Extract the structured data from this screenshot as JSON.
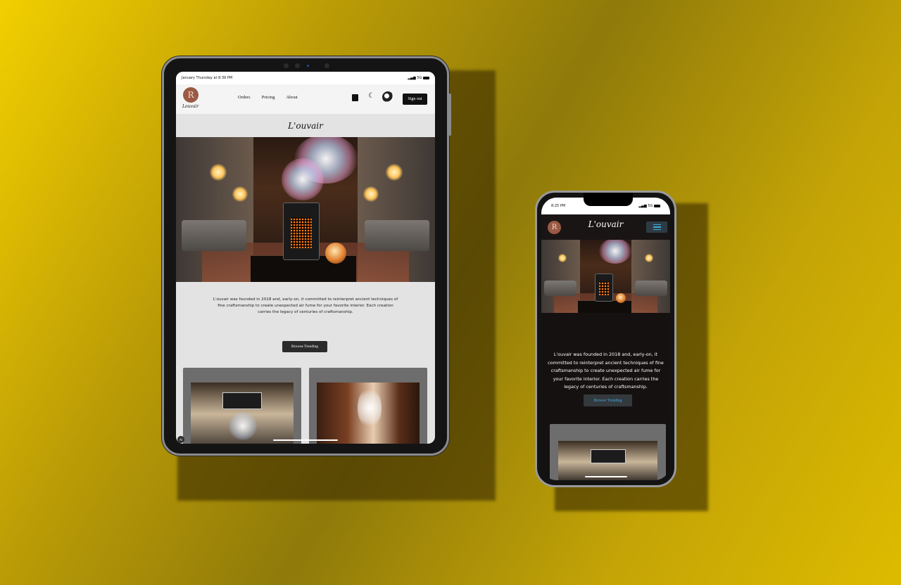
{
  "tablet": {
    "status": {
      "time": "January Thursday at 8:39 PM",
      "signal": "5G"
    },
    "nav": {
      "logo_letter": "R",
      "logo_text": "Louvair",
      "links": [
        "Orders",
        "Pricing",
        "About"
      ],
      "icons": [
        "shopping-bag-icon",
        "moon-icon",
        "profile-brush-icon"
      ],
      "sign_out": "Sign out"
    },
    "hero_title": "L'ouvair",
    "description": "L'ouvair was founded in 2018 and, early-on, it committed to reinterpret ancient techniques of fine craftsmanship to create unexpected air fume for your favorite interior. Each creation carries the legacy of centuries of craftsmanship.",
    "browse_button": "Browse Trending",
    "badge": "AI"
  },
  "phone": {
    "status": {
      "time": "8:25 PM",
      "signal": "5G"
    },
    "logo_letter": "R",
    "title": "L'ouvair",
    "description": "L'ouvair was founded in 2018 and, early-on, it committed to reinterpret ancient techniques of fine craftsmanship to create unexpected air fume for your favorite interior. Each creation carries the legacy of centuries of craftsmanship.",
    "browse_button": "Browse Trending"
  },
  "colors": {
    "background": "#c9a704",
    "accent_blue": "#3fa8d8",
    "logo_bg": "#9a5a45",
    "dark_bg": "#151111"
  }
}
